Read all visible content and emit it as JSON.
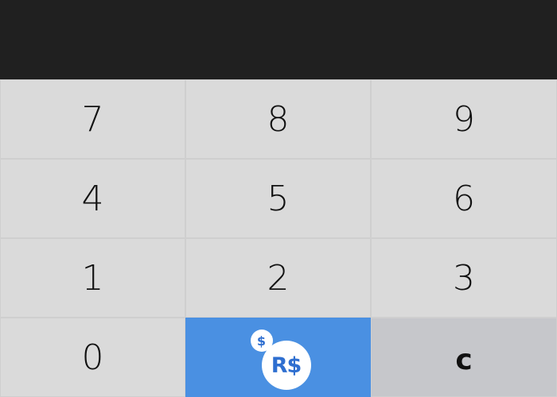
{
  "display": {
    "value": ""
  },
  "keys": {
    "k7": "7",
    "k8": "8",
    "k9": "9",
    "k4": "4",
    "k5": "5",
    "k6": "6",
    "k1": "1",
    "k2": "2",
    "k3": "3",
    "k0": "0",
    "clear": "c"
  },
  "currency_button": {
    "coin_label": "R$",
    "badge_label": "$",
    "icon": "robux-coin-icon",
    "color": "#4a90e2"
  },
  "colors": {
    "display_bg": "#202020",
    "key_bg": "#dadada",
    "clear_key_bg": "#c6c7cb",
    "accent": "#4a90e2"
  }
}
